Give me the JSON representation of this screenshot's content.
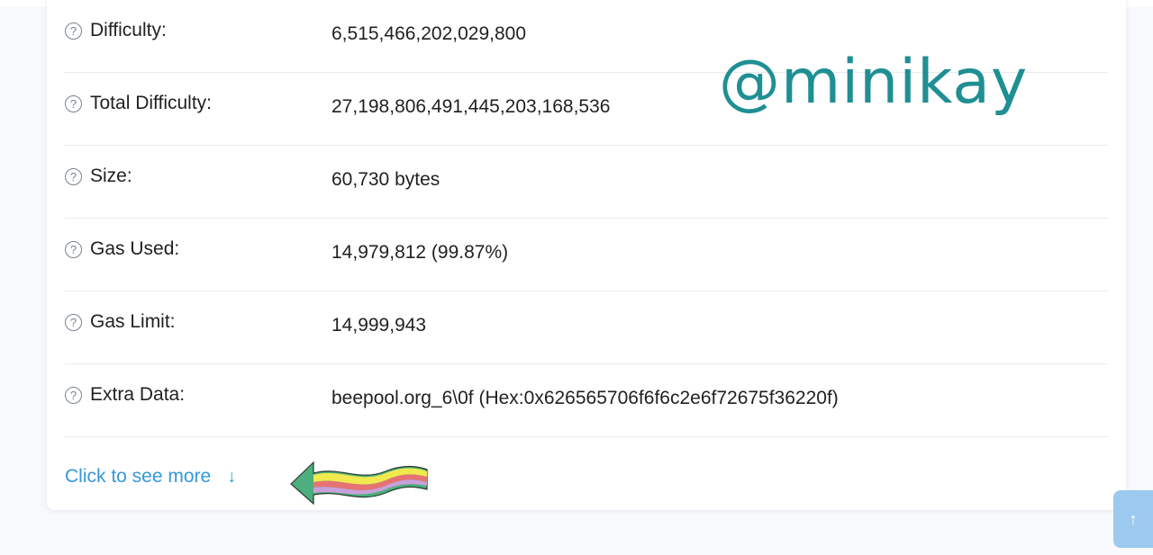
{
  "details": {
    "rows": [
      {
        "label": "Difficulty:",
        "value": "6,515,466,202,029,800"
      },
      {
        "label": "Total Difficulty:",
        "value": "27,198,806,491,445,203,168,536"
      },
      {
        "label": "Size:",
        "value": "60,730 bytes"
      },
      {
        "label": "Gas Used:",
        "value": "14,979,812 (99.87%)"
      },
      {
        "label": "Gas Limit:",
        "value": "14,999,943"
      },
      {
        "label": "Extra Data:",
        "value": "beepool.org_6\\0f (Hex:0x626565706f6f6c2e6f72675f36220f)"
      }
    ],
    "help_glyph": "?",
    "see_more_label": "Click to see more",
    "see_more_icon": "↓"
  },
  "watermark": {
    "text": "@minikay",
    "color": "#1f8f93"
  },
  "scroll_top": {
    "icon": "↑"
  },
  "colors": {
    "link": "#3498db",
    "scroll_top_bg": "#9cc9ef",
    "divider": "#e7eaf3"
  }
}
